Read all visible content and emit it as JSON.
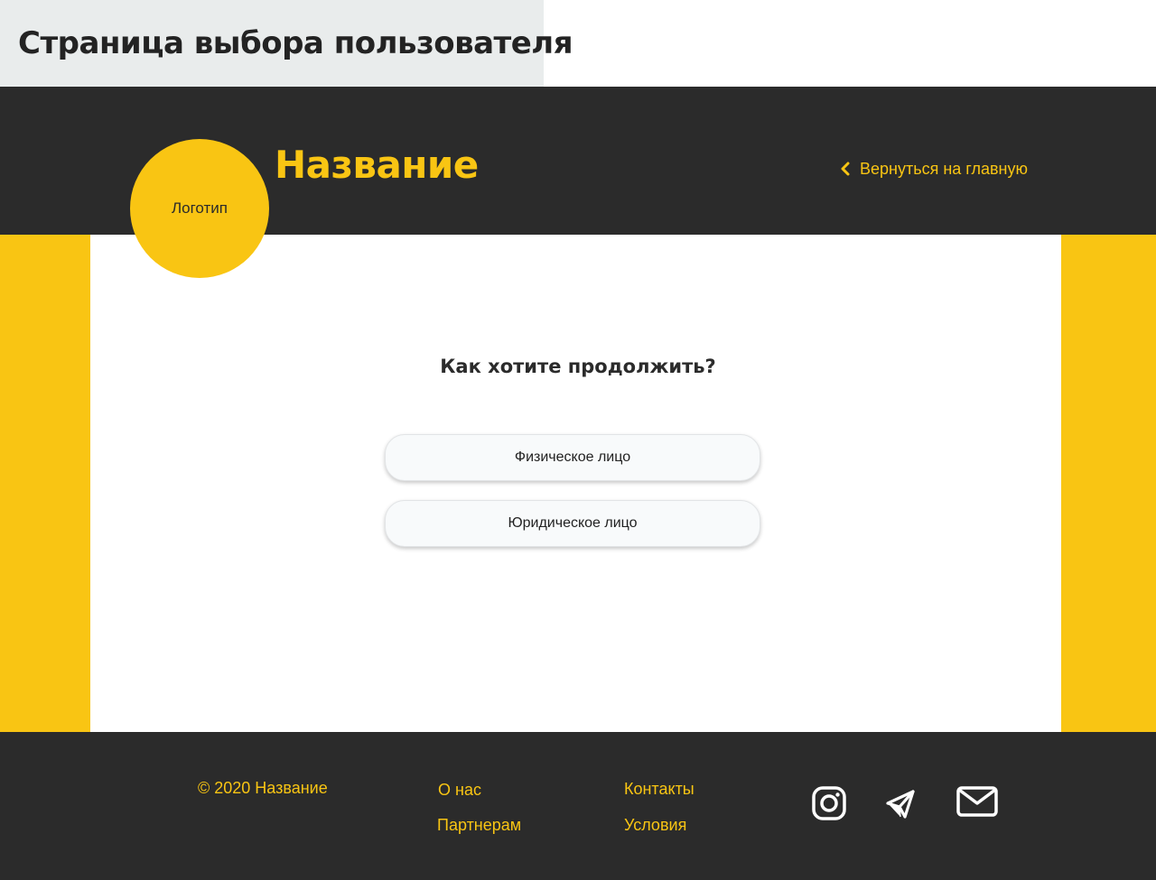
{
  "caption": "Страница выбора пользователя",
  "header": {
    "logo_text": "Логотип",
    "title": "Название",
    "back_link": "Вернуться на главную"
  },
  "main": {
    "question": "Как хотите продолжить?",
    "options": [
      "Физическое лицо",
      "Юридическое лицо"
    ]
  },
  "footer": {
    "copyright": "© 2020 Название",
    "links": [
      "О нас",
      "Партнерам",
      "Контакты",
      "Условия"
    ],
    "social_icons": [
      "instagram-icon",
      "telegram-icon",
      "mail-icon"
    ]
  },
  "colors": {
    "accent": "#f9c513",
    "dark": "#2b2b2b",
    "caption_bg": "#e9ecec",
    "button_bg": "#f8fafb"
  }
}
